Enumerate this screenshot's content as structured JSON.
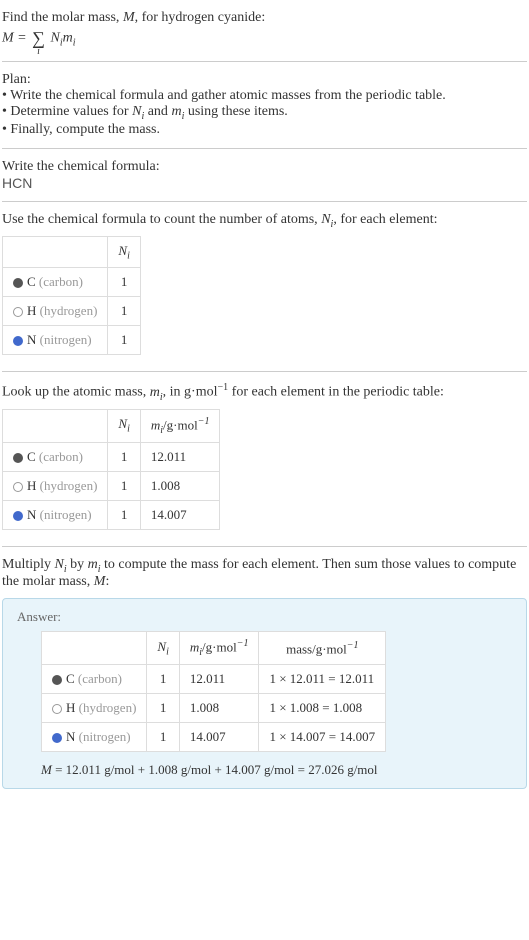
{
  "intro": {
    "line1": "Find the molar mass, ",
    "line1_var": "M",
    "line1_end": ", for hydrogen cyanide:",
    "formula_M": "M",
    "formula_eq": " = ",
    "formula_sub": "i",
    "formula_rhs1": "N",
    "formula_rhs2": "m"
  },
  "plan": {
    "title": "Plan:",
    "items": [
      "Write the chemical formula and gather atomic masses from the periodic table.",
      "Determine values for Nᵢ and mᵢ using these items.",
      "Finally, compute the mass."
    ]
  },
  "step1": {
    "title": "Write the chemical formula:",
    "formula": "HCN"
  },
  "step2": {
    "prefix": "Use the chemical formula to count the number of atoms, ",
    "var": "N",
    "sub": "i",
    "suffix": ", for each element:",
    "header_N": "N",
    "header_N_sub": "i",
    "rows": [
      {
        "symbol": "C",
        "name": "(carbon)",
        "dot": "dot-carbon",
        "N": "1"
      },
      {
        "symbol": "H",
        "name": "(hydrogen)",
        "dot": "dot-hydrogen",
        "N": "1"
      },
      {
        "symbol": "N",
        "name": "(nitrogen)",
        "dot": "dot-nitrogen",
        "N": "1"
      }
    ]
  },
  "step3": {
    "prefix": "Look up the atomic mass, ",
    "var": "m",
    "sub": "i",
    "mid": ", in g·mol",
    "sup": "−1",
    "suffix": " for each element in the periodic table:",
    "header_N": "N",
    "header_m": "m",
    "header_m_sub": "i",
    "header_m_unit": "/g·mol",
    "header_m_sup": "−1",
    "rows": [
      {
        "symbol": "C",
        "name": "(carbon)",
        "dot": "dot-carbon",
        "N": "1",
        "m": "12.011"
      },
      {
        "symbol": "H",
        "name": "(hydrogen)",
        "dot": "dot-hydrogen",
        "N": "1",
        "m": "1.008"
      },
      {
        "symbol": "N",
        "name": "(nitrogen)",
        "dot": "dot-nitrogen",
        "N": "1",
        "m": "14.007"
      }
    ]
  },
  "step4": {
    "prefix": "Multiply ",
    "N": "N",
    "sub": "i",
    "mid1": " by ",
    "m": "m",
    "mid2": " to compute the mass for each element. Then sum those values to compute the molar mass, ",
    "M": "M",
    "end": ":"
  },
  "answer": {
    "label": "Answer:",
    "header_N": "N",
    "header_N_sub": "i",
    "header_m": "m",
    "header_m_sub": "i",
    "header_m_unit": "/g·mol",
    "header_m_sup": "−1",
    "header_mass": "mass/g·mol",
    "header_mass_sup": "−1",
    "rows": [
      {
        "symbol": "C",
        "name": "(carbon)",
        "dot": "dot-carbon",
        "N": "1",
        "m": "12.011",
        "mass": "1 × 12.011 = 12.011"
      },
      {
        "symbol": "H",
        "name": "(hydrogen)",
        "dot": "dot-hydrogen",
        "N": "1",
        "m": "1.008",
        "mass": "1 × 1.008 = 1.008"
      },
      {
        "symbol": "N",
        "name": "(nitrogen)",
        "dot": "dot-nitrogen",
        "N": "1",
        "m": "14.007",
        "mass": "1 × 14.007 = 14.007"
      }
    ],
    "final_M": "M",
    "final_eq": " = 12.011 g/mol + 1.008 g/mol + 14.007 g/mol = 27.026 g/mol"
  }
}
